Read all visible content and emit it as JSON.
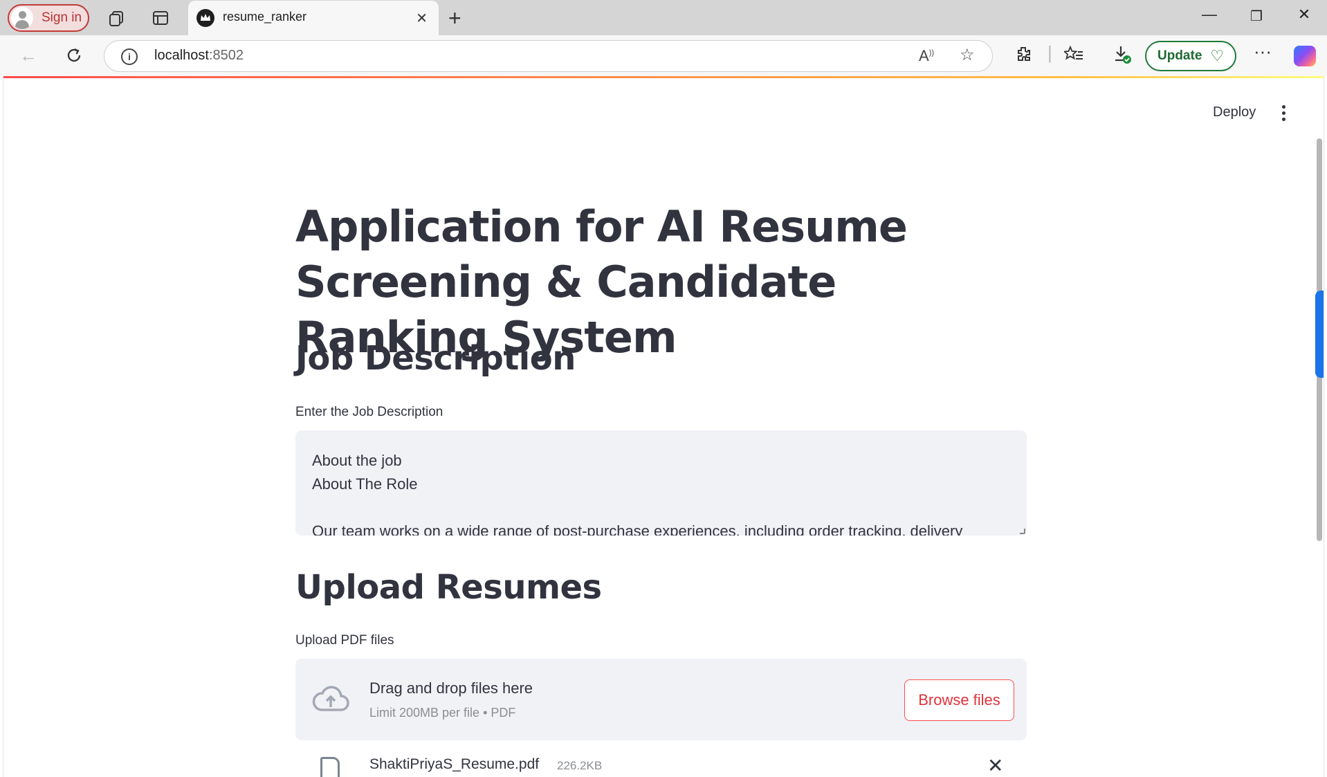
{
  "browser": {
    "signin_label": "Sign in",
    "tab_title": "resume_ranker",
    "url_host": "localhost",
    "url_port": ":8502",
    "update_label": "Update"
  },
  "app": {
    "deploy_label": "Deploy",
    "title": "Application for AI Resume Screening & Candidate Ranking System",
    "job_section": {
      "heading": "Job Description",
      "input_label": "Enter the Job Description",
      "lines": [
        "About the job",
        "About The Role",
        "",
        "Our team works on a wide range of post-purchase experiences, including order tracking, delivery"
      ]
    },
    "upload_section": {
      "heading": "Upload Resumes",
      "input_label": "Upload PDF files",
      "dropzone_title": "Drag and drop files here",
      "dropzone_limit": "Limit 200MB per file • PDF",
      "browse_label": "Browse files",
      "files": [
        {
          "name": "ShaktiPriyaS_Resume.pdf",
          "size": "226.2KB"
        }
      ]
    }
  },
  "colors": {
    "primary": "#ff4b4b",
    "text": "#31333f",
    "widget_bg": "#f0f2f6",
    "update_green": "#1e7a37"
  }
}
